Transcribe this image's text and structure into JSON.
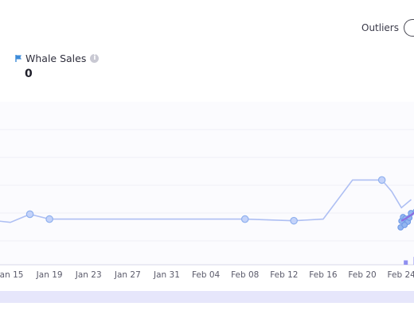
{
  "header": {
    "outliers_label": "Outliers"
  },
  "stat": {
    "label": "Whale Sales",
    "value": "0",
    "accent": "#3d8bd9"
  },
  "chart_data": {
    "type": "scatter",
    "x_ticks": [
      "Jan 15",
      "Jan 19",
      "Jan 23",
      "Jan 27",
      "Jan 31",
      "Feb 04",
      "Feb 08",
      "Feb 12",
      "Feb 16",
      "Feb 20",
      "Feb 24"
    ],
    "series": [
      {
        "line_color": "#aebff3",
        "points": [
          [
            "Jan 12",
            0.28
          ],
          [
            "Jan 15",
            0.26
          ],
          [
            "Jan 17",
            0.31
          ],
          [
            "Jan 19",
            0.28
          ],
          [
            "Feb 08",
            0.28
          ],
          [
            "Feb 13",
            0.27
          ],
          [
            "Feb 16",
            0.28
          ],
          [
            "Feb 19",
            0.52
          ],
          [
            "Feb 22",
            0.52
          ],
          [
            "Feb 23",
            0.45
          ],
          [
            "Feb 24",
            0.35
          ],
          [
            "Feb 25",
            0.4
          ]
        ]
      }
    ],
    "markers": [
      {
        "x": "Jan 17",
        "y": 0.31
      },
      {
        "x": "Jan 19",
        "y": 0.28
      },
      {
        "x": "Feb 08",
        "y": 0.28
      },
      {
        "x": "Feb 13",
        "y": 0.27
      },
      {
        "x": "Feb 22",
        "y": 0.52
      }
    ],
    "volume_bars": [
      {
        "x": "Feb 24",
        "value": 0.5
      },
      {
        "x": "Feb 25",
        "value": 0.9
      }
    ],
    "grid": true
  }
}
